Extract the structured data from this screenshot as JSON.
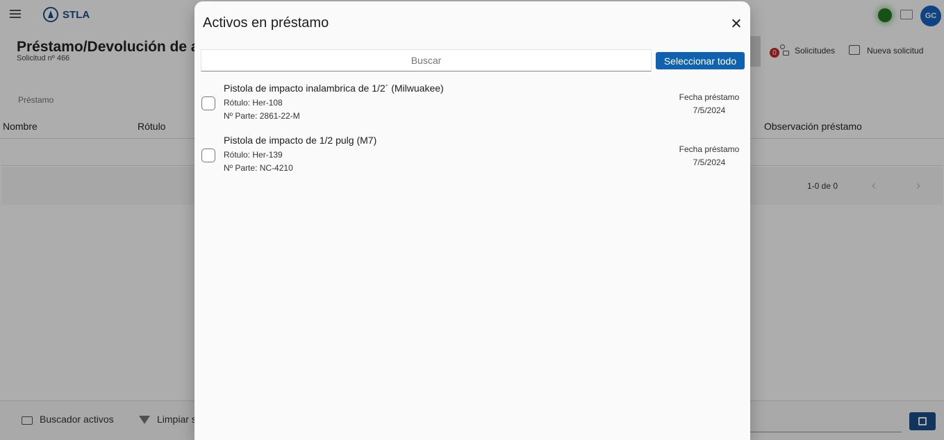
{
  "app": {
    "brand": "STLA",
    "page_title": "Préstamo/Devolución de acti",
    "request_number": "Solicitud nº 466",
    "avatar_initials": "GC",
    "requests_badge": "0",
    "requests_label": "Solicitudes",
    "new_request_label": "Nueva solicitud",
    "section_label": "Préstamo",
    "table": {
      "columns": [
        "Nombre",
        "Rótulo",
        "Observación préstamo"
      ],
      "pagination": "1-0 de 0"
    },
    "bottom": {
      "asset_search_label": "Buscador activos",
      "clear_label": "Limpiar s"
    },
    "colors": {
      "primary": "#1062b0",
      "status_online": "#1f7a1f",
      "badge": "#c62828"
    }
  },
  "modal": {
    "title": "Activos en préstamo",
    "search_placeholder": "Buscar",
    "select_all_label": "Seleccionar todo",
    "items": [
      {
        "name": "Pistola de impacto inalambrica de 1/2´ (Milwuakee)",
        "label": "Rótulo: Her-108",
        "part": "Nº Parte: 2861-22-M",
        "date_label": "Fecha préstamo",
        "date": "7/5/2024",
        "checked": false
      },
      {
        "name": "Pistola de impacto de 1/2 pulg (M7)",
        "label": "Rótulo: Her-139",
        "part": "Nº Parte: NC-4210",
        "date_label": "Fecha préstamo",
        "date": "7/5/2024",
        "checked": false
      }
    ]
  }
}
